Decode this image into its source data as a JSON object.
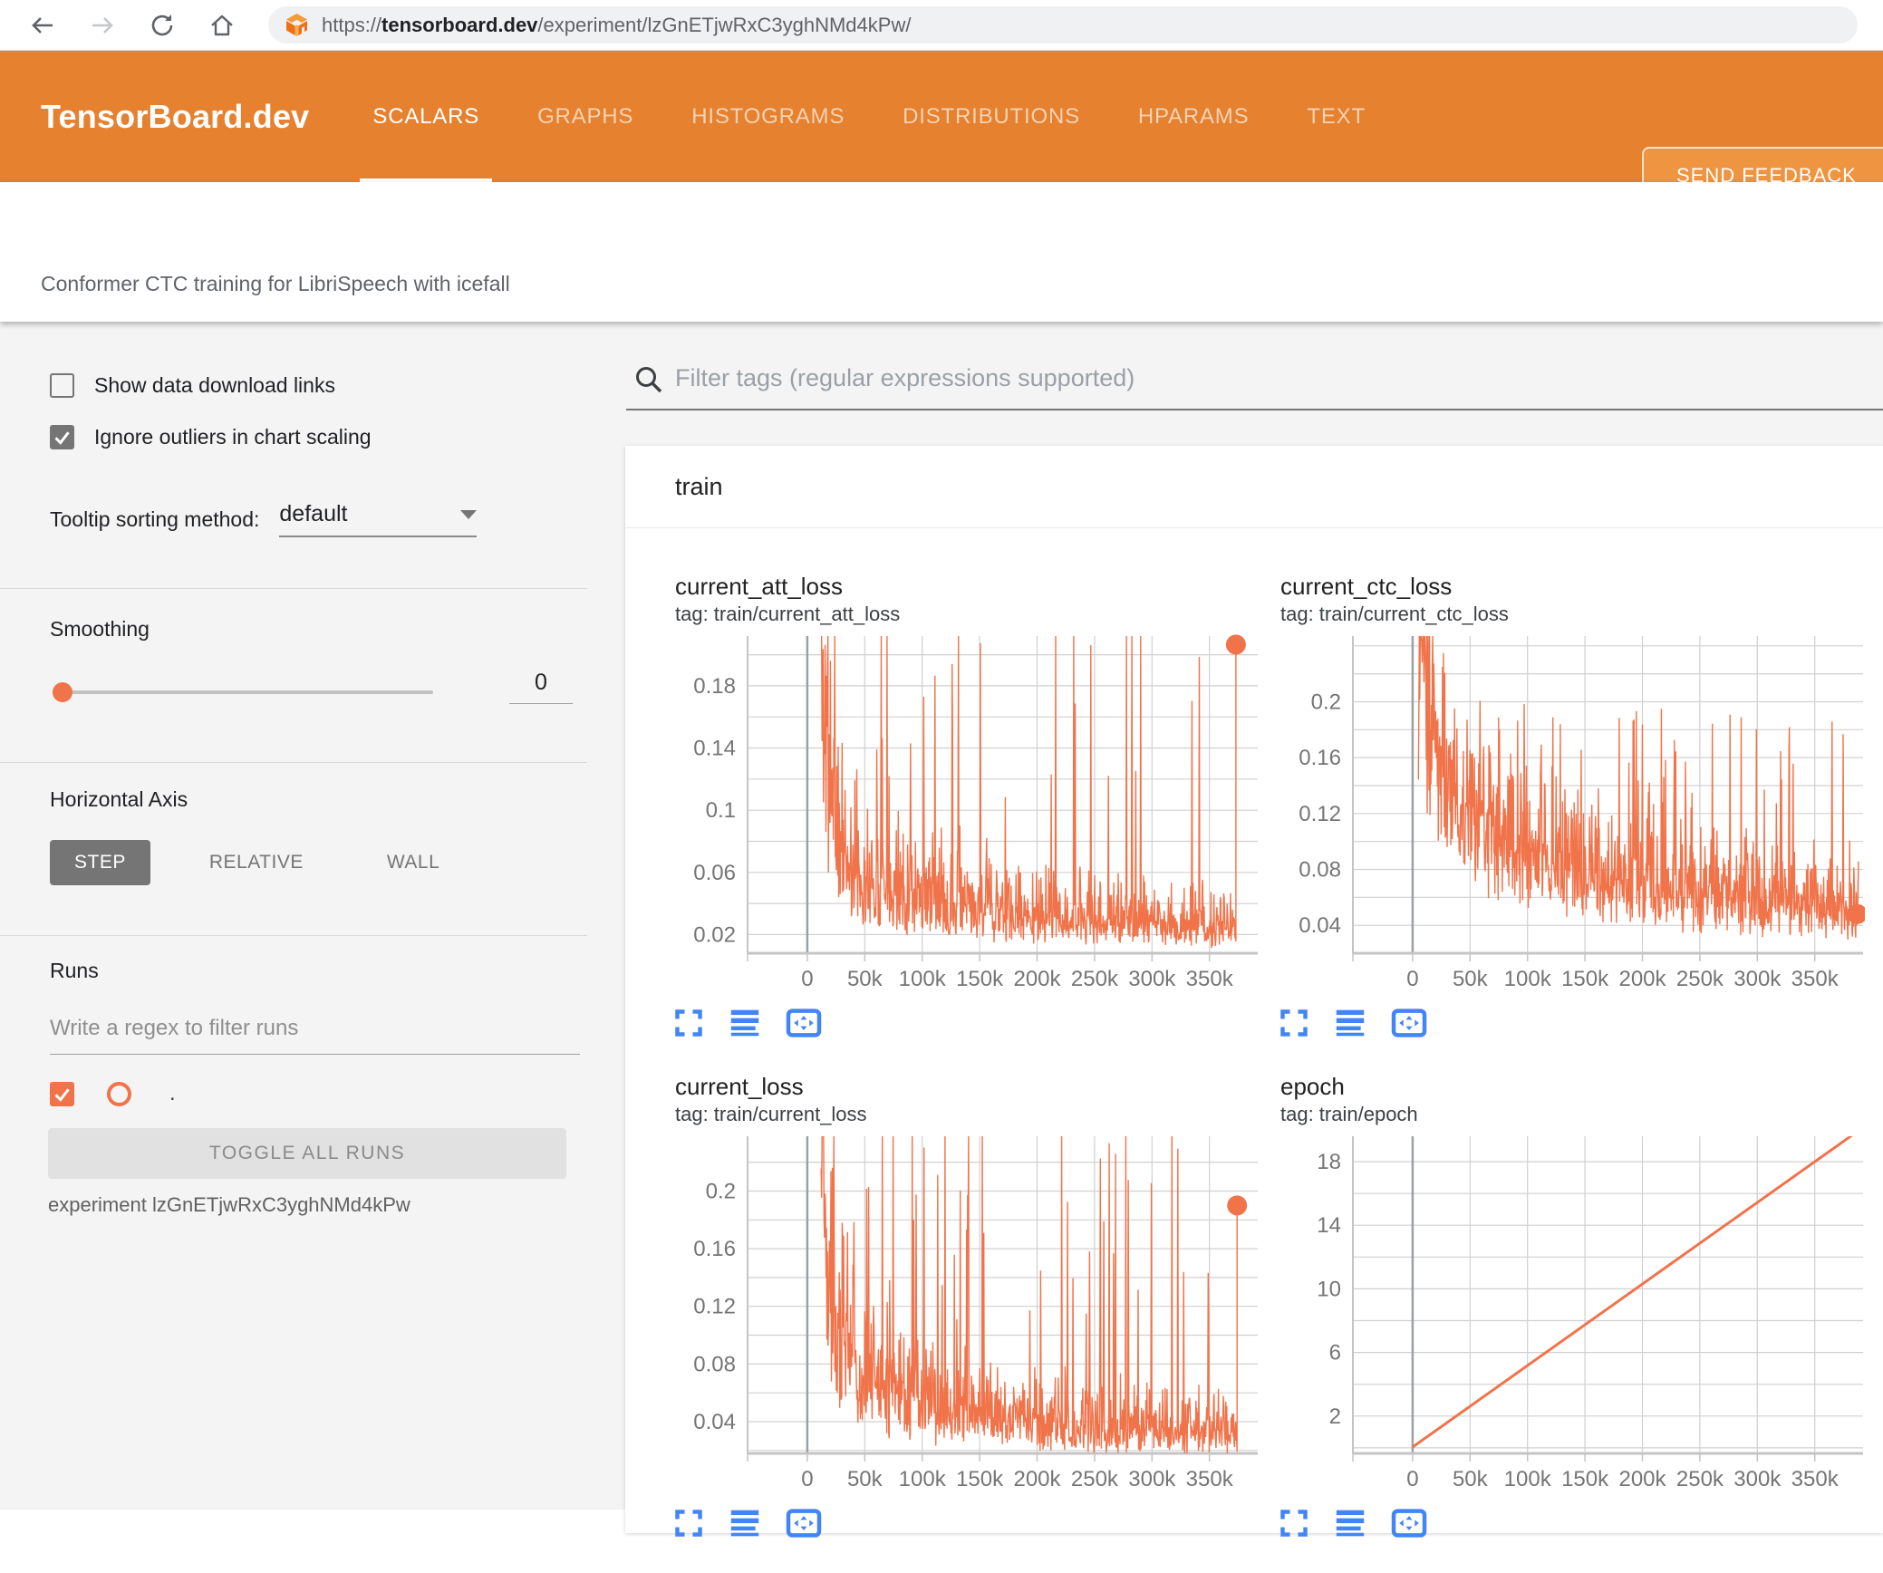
{
  "browser": {
    "url_scheme": "https://",
    "url_domain": "tensorboard.dev",
    "url_path": "/experiment/lzGnETjwRxC3yghNMd4kPw/"
  },
  "header": {
    "logo": "TensorBoard.dev",
    "tabs": [
      {
        "label": "SCALARS",
        "active": true
      },
      {
        "label": "GRAPHS",
        "active": false
      },
      {
        "label": "HISTOGRAMS",
        "active": false
      },
      {
        "label": "DISTRIBUTIONS",
        "active": false
      },
      {
        "label": "HPARAMS",
        "active": false
      },
      {
        "label": "TEXT",
        "active": false
      }
    ],
    "feedback_label": "SEND FEEDBACK"
  },
  "subheader": {
    "experiment_title": "Conformer CTC training for LibriSpeech with icefall"
  },
  "sidebar": {
    "checkboxes": [
      {
        "label": "Show data download links",
        "checked": false
      },
      {
        "label": "Ignore outliers in chart scaling",
        "checked": true
      }
    ],
    "tooltip_sorting": {
      "label": "Tooltip sorting method:",
      "value": "default"
    },
    "smoothing": {
      "label": "Smoothing",
      "value": "0"
    },
    "horizontal_axis": {
      "label": "Horizontal Axis",
      "options": [
        {
          "label": "STEP",
          "selected": true
        },
        {
          "label": "RELATIVE",
          "selected": false
        },
        {
          "label": "WALL",
          "selected": false
        }
      ]
    },
    "runs": {
      "label": "Runs",
      "filter_placeholder": "Write a regex to filter runs",
      "run_item": {
        "name": ".",
        "checked": true
      },
      "toggle_button": "TOGGLE ALL RUNS",
      "experiment_note": "experiment lzGnETjwRxC3yghNMd4kPw"
    }
  },
  "main": {
    "filter_placeholder": "Filter tags (regular expressions supported)",
    "section_title": "train"
  },
  "colors": {
    "header_orange": "#e5812f",
    "accent_orange": "#f0734a",
    "icon_blue": "#4285f4",
    "grid_gray": "#d0d0d0",
    "axis_gray": "#c4c4c4",
    "zero_line_gray": "#9aa0a6",
    "tick_label_gray": "#757575"
  },
  "chart_data": [
    {
      "id": "current_att_loss",
      "type": "line",
      "title": "current_att_loss",
      "tag": "tag: train/current_att_loss",
      "x_domain": [
        -52000,
        392000
      ],
      "x_tick_values": [
        0,
        50000,
        100000,
        150000,
        200000,
        250000,
        300000,
        350000
      ],
      "x_tick_labels": [
        "0",
        "50k",
        "100k",
        "150k",
        "200k",
        "250k",
        "300k",
        "350k"
      ],
      "y_domain": [
        0.008,
        0.212
      ],
      "y_grid": {
        "start": 0.02,
        "end": 0.2,
        "step": 0.02
      },
      "y_tick_values": [
        0.02,
        0.06,
        0.1,
        0.14,
        0.18
      ],
      "y_tick_labels": [
        "0.02",
        "0.06",
        "0.1",
        "0.14",
        "0.18"
      ],
      "grid": true,
      "legend": false,
      "line_color": "#f0734a",
      "series": {
        "style": "noisy",
        "seed": 11,
        "points": 850,
        "x_start": 12000,
        "x_end": 373000,
        "noise_sigma": 0.42,
        "spike_prob": 0.045,
        "spike_min": 0.08,
        "spike_max": 0.24,
        "trend": [
          [
            12000,
            0.212
          ],
          [
            18000,
            0.13
          ],
          [
            25000,
            0.085
          ],
          [
            40000,
            0.06
          ],
          [
            60000,
            0.05
          ],
          [
            90000,
            0.045
          ],
          [
            130000,
            0.038
          ],
          [
            170000,
            0.033
          ],
          [
            220000,
            0.03
          ],
          [
            270000,
            0.028
          ],
          [
            320000,
            0.026
          ],
          [
            373000,
            0.024
          ]
        ]
      },
      "end_marker": {
        "x": 373000,
        "y": 0.2065
      }
    },
    {
      "id": "current_ctc_loss",
      "type": "line",
      "title": "current_ctc_loss",
      "tag": "tag: train/current_ctc_loss",
      "x_domain": [
        -52000,
        392000
      ],
      "x_tick_values": [
        0,
        50000,
        100000,
        150000,
        200000,
        250000,
        300000,
        350000
      ],
      "x_tick_labels": [
        "0",
        "50k",
        "100k",
        "150k",
        "200k",
        "250k",
        "300k",
        "350k"
      ],
      "y_domain": [
        0.02,
        0.247
      ],
      "y_grid": {
        "start": 0.04,
        "end": 0.24,
        "step": 0.02
      },
      "y_tick_values": [
        0.04,
        0.08,
        0.12,
        0.16,
        0.2
      ],
      "y_tick_labels": [
        "0.04",
        "0.08",
        "0.12",
        "0.16",
        "0.2"
      ],
      "grid": true,
      "legend": false,
      "line_color": "#f0734a",
      "series": {
        "style": "noisy",
        "seed": 23,
        "points": 950,
        "x_start": 5000,
        "x_end": 388000,
        "noise_sigma": 0.32,
        "spike_prob": 0.04,
        "spike_min": 0.1,
        "spike_max": 0.2,
        "trend": [
          [
            5000,
            0.247
          ],
          [
            15000,
            0.2
          ],
          [
            30000,
            0.15
          ],
          [
            50000,
            0.12
          ],
          [
            70000,
            0.105
          ],
          [
            100000,
            0.09
          ],
          [
            140000,
            0.08
          ],
          [
            180000,
            0.072
          ],
          [
            220000,
            0.065
          ],
          [
            260000,
            0.062
          ],
          [
            300000,
            0.058
          ],
          [
            340000,
            0.053
          ],
          [
            388000,
            0.05
          ]
        ]
      },
      "end_marker": {
        "x": 387000,
        "y": 0.048
      }
    },
    {
      "id": "current_loss",
      "type": "line",
      "title": "current_loss",
      "tag": "tag: train/current_loss",
      "x_domain": [
        -52000,
        392000
      ],
      "x_tick_values": [
        0,
        50000,
        100000,
        150000,
        200000,
        250000,
        300000,
        350000
      ],
      "x_tick_labels": [
        "0",
        "50k",
        "100k",
        "150k",
        "200k",
        "250k",
        "300k",
        "350k"
      ],
      "y_domain": [
        0.018,
        0.238
      ],
      "y_grid": {
        "start": 0.02,
        "end": 0.22,
        "step": 0.02
      },
      "y_tick_values": [
        0.04,
        0.08,
        0.12,
        0.16,
        0.2
      ],
      "y_tick_labels": [
        "0.04",
        "0.08",
        "0.12",
        "0.16",
        "0.2"
      ],
      "grid": true,
      "legend": false,
      "line_color": "#f0734a",
      "series": {
        "style": "noisy",
        "seed": 37,
        "points": 850,
        "x_start": 12000,
        "x_end": 374000,
        "noise_sigma": 0.4,
        "spike_prob": 0.05,
        "spike_min": 0.09,
        "spike_max": 0.26,
        "trend": [
          [
            12000,
            0.238
          ],
          [
            18000,
            0.15
          ],
          [
            25000,
            0.1
          ],
          [
            40000,
            0.075
          ],
          [
            60000,
            0.062
          ],
          [
            90000,
            0.055
          ],
          [
            130000,
            0.047
          ],
          [
            170000,
            0.042
          ],
          [
            220000,
            0.038
          ],
          [
            270000,
            0.036
          ],
          [
            320000,
            0.034
          ],
          [
            374000,
            0.032
          ]
        ]
      },
      "end_marker": {
        "x": 374000,
        "y": 0.19
      }
    },
    {
      "id": "epoch",
      "type": "line",
      "title": "epoch",
      "tag": "tag: train/epoch",
      "x_domain": [
        -52000,
        392000
      ],
      "x_tick_values": [
        0,
        50000,
        100000,
        150000,
        200000,
        250000,
        300000,
        350000
      ],
      "x_tick_labels": [
        "0",
        "50k",
        "100k",
        "150k",
        "200k",
        "250k",
        "300k",
        "350k"
      ],
      "y_domain": [
        -0.35,
        19.6
      ],
      "y_grid": {
        "start": 0,
        "end": 18,
        "step": 2
      },
      "y_tick_values": [
        2,
        6,
        10,
        14,
        18
      ],
      "y_tick_labels": [
        "2",
        "6",
        "10",
        "14",
        "18"
      ],
      "grid": true,
      "legend": false,
      "line_color": "#f0734a",
      "series": {
        "style": "linear",
        "points_xy": [
          [
            0,
            0.05
          ],
          [
            388000,
            19.95
          ]
        ]
      },
      "end_marker": null
    }
  ]
}
